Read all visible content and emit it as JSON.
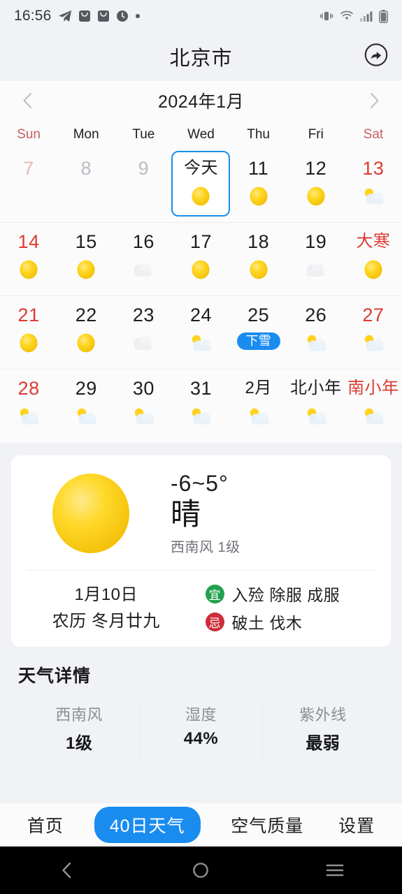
{
  "status_bar": {
    "time": "16:56",
    "left_icons": [
      "telegram-icon",
      "mail-icon",
      "mail-icon",
      "clock-icon",
      "dot-icon"
    ],
    "right_icons": [
      "vibrate-icon",
      "wifi-icon",
      "signal-icon",
      "battery-icon"
    ]
  },
  "header": {
    "title": "北京市",
    "share_icon": "share-icon"
  },
  "month_nav": {
    "prev_icon": "chevron-left-icon",
    "label": "2024年1月",
    "next_icon": "chevron-right-icon"
  },
  "weekdays": [
    {
      "label": "Sun",
      "red": true
    },
    {
      "label": "Mon",
      "red": false
    },
    {
      "label": "Tue",
      "red": false
    },
    {
      "label": "Wed",
      "red": false
    },
    {
      "label": "Thu",
      "red": false
    },
    {
      "label": "Fri",
      "red": false
    },
    {
      "label": "Sat",
      "red": true
    }
  ],
  "calendar": {
    "rows": [
      [
        {
          "day": "7",
          "style": "pastred",
          "icon": "none"
        },
        {
          "day": "8",
          "style": "past",
          "icon": "none"
        },
        {
          "day": "9",
          "style": "past",
          "icon": "none"
        },
        {
          "day": "今天",
          "style": "today",
          "icon": "sunny",
          "cn": true
        },
        {
          "day": "11",
          "style": "normal",
          "icon": "sunny"
        },
        {
          "day": "12",
          "style": "normal",
          "icon": "sunny"
        },
        {
          "day": "13",
          "style": "red",
          "icon": "partly-cloudy"
        }
      ],
      [
        {
          "day": "14",
          "style": "red",
          "icon": "sunny"
        },
        {
          "day": "15",
          "style": "normal",
          "icon": "sunny"
        },
        {
          "day": "16",
          "style": "normal",
          "icon": "cloudy"
        },
        {
          "day": "17",
          "style": "normal",
          "icon": "sunny"
        },
        {
          "day": "18",
          "style": "normal",
          "icon": "sunny"
        },
        {
          "day": "19",
          "style": "normal",
          "icon": "cloudy"
        },
        {
          "day": "大寒",
          "style": "red",
          "icon": "sunny",
          "cn": true
        }
      ],
      [
        {
          "day": "21",
          "style": "red",
          "icon": "sunny"
        },
        {
          "day": "22",
          "style": "normal",
          "icon": "sunny"
        },
        {
          "day": "23",
          "style": "normal",
          "icon": "cloudy"
        },
        {
          "day": "24",
          "style": "normal",
          "icon": "partly-cloudy"
        },
        {
          "day": "25",
          "style": "normal",
          "icon": "badge",
          "badge": "下雪"
        },
        {
          "day": "26",
          "style": "normal",
          "icon": "partly-cloudy"
        },
        {
          "day": "27",
          "style": "red",
          "icon": "partly-cloudy"
        }
      ],
      [
        {
          "day": "28",
          "style": "red",
          "icon": "partly-cloudy"
        },
        {
          "day": "29",
          "style": "normal",
          "icon": "partly-cloudy"
        },
        {
          "day": "30",
          "style": "normal",
          "icon": "partly-cloudy"
        },
        {
          "day": "31",
          "style": "normal",
          "icon": "partly-cloudy"
        },
        {
          "day": "2月",
          "style": "normal",
          "icon": "partly-cloudy",
          "cn": true
        },
        {
          "day": "北小年",
          "style": "normal",
          "icon": "partly-cloudy",
          "cn": true
        },
        {
          "day": "南小年",
          "style": "red",
          "icon": "partly-cloudy",
          "cn": true
        }
      ]
    ]
  },
  "weather_card": {
    "icon": "sunny-large-icon",
    "temperature": "-6~5°",
    "condition": "晴",
    "wind": "西南风 1级",
    "date_solar": "1月10日",
    "date_lunar": "农历 冬月廿九",
    "yi": {
      "badge": "宜",
      "items": "入殓 除服 成服",
      "color": "#22a04f"
    },
    "ji": {
      "badge": "忌",
      "items": "破土 伐木",
      "color": "#cf2b3a"
    }
  },
  "details": {
    "title": "天气详情",
    "columns": [
      {
        "label": "西南风",
        "value": "1级"
      },
      {
        "label": "湿度",
        "value": "44%"
      },
      {
        "label": "紫外线",
        "value": "最弱"
      }
    ]
  },
  "tabs": [
    {
      "label": "首页",
      "active": false
    },
    {
      "label": "40日天气",
      "active": true
    },
    {
      "label": "空气质量",
      "active": false
    },
    {
      "label": "设置",
      "active": false
    }
  ],
  "android_nav": {
    "back_icon": "back-icon",
    "home_icon": "home-icon",
    "recents_icon": "recents-icon"
  },
  "colors": {
    "accent": "#1a8cf0",
    "today_border": "#1a8fe8",
    "holiday_red": "#dd3b31",
    "weekend_red": "#c8605f",
    "sun_yellow": "#ffd21e",
    "page_bg": "#f1f2f5"
  }
}
